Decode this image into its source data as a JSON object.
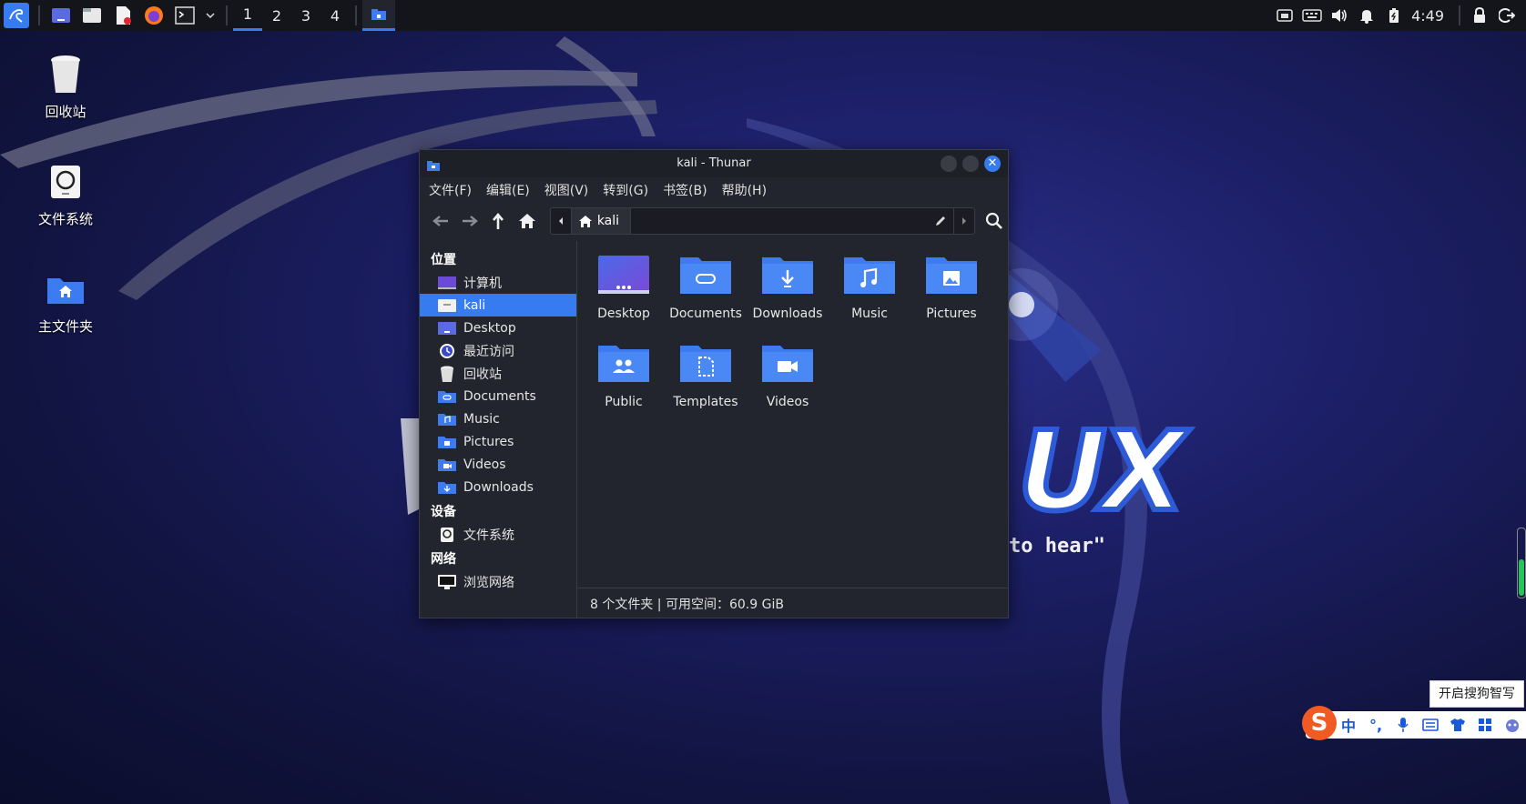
{
  "panel": {
    "workspaces": [
      "1",
      "2",
      "3",
      "4"
    ],
    "clock": "4:49"
  },
  "desktop": {
    "icons": [
      {
        "label": "回收站"
      },
      {
        "label": "文件系统"
      },
      {
        "label": "主文件夹"
      }
    ],
    "bg_slogan": "to hear\"",
    "bg_logo_fragment": "UX"
  },
  "window": {
    "title": "kali - Thunar",
    "menu": [
      "文件(F)",
      "编辑(E)",
      "视图(V)",
      "转到(G)",
      "书签(B)",
      "帮助(H)"
    ],
    "path_crumb": "kali",
    "sidebar": {
      "places_header": "位置",
      "places": [
        "计算机",
        "kali",
        "Desktop",
        "最近访问",
        "回收站",
        "Documents",
        "Music",
        "Pictures",
        "Videos",
        "Downloads"
      ],
      "selected": "kali",
      "devices_header": "设备",
      "devices": [
        "文件系统"
      ],
      "network_header": "网络",
      "network": [
        "浏览网络"
      ]
    },
    "files": [
      "Desktop",
      "Documents",
      "Downloads",
      "Music",
      "Pictures",
      "Public",
      "Templates",
      "Videos"
    ],
    "status": "8 个文件夹 | 可用空间：60.9 GiB"
  },
  "ime": {
    "tip": "开启搜狗智写",
    "logo": "S",
    "mode": "中",
    "punct": "°,"
  },
  "colors": {
    "accent": "#367bf0",
    "folder": "#3d7cf0",
    "window_bg": "#23252e"
  }
}
